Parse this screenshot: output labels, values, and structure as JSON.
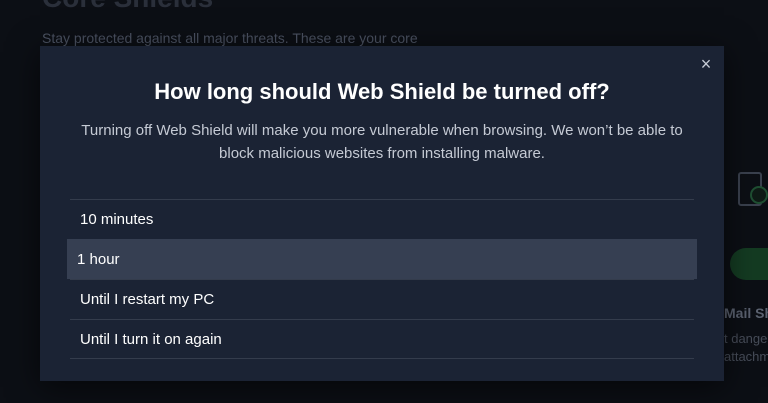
{
  "background": {
    "title": "Core Shields",
    "subtitle": "Stay protected against all major threats. These are your core",
    "card_title": "Mail Sh",
    "card_desc_line1": "t dange",
    "card_desc_line2": "attachm"
  },
  "modal": {
    "title": "How long should Web Shield be turned off?",
    "description": "Turning off Web Shield will make you more vulnerable when browsing. We won’t be able to block malicious websites from installing malware.",
    "close_icon": "×",
    "options": [
      {
        "label": "10 minutes"
      },
      {
        "label": "1 hour"
      },
      {
        "label": "Until I restart my PC"
      },
      {
        "label": "Until I turn it on again"
      }
    ],
    "selected_index": 1
  }
}
